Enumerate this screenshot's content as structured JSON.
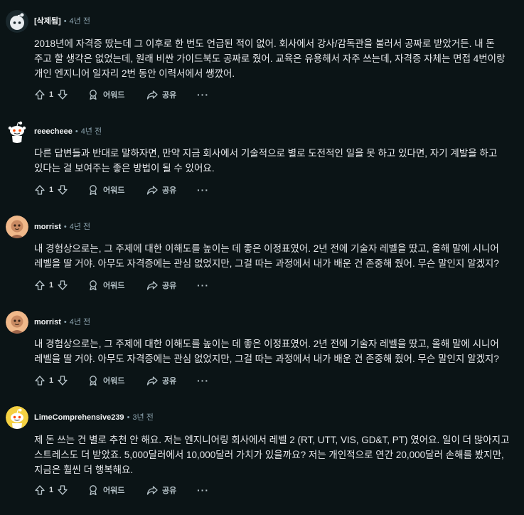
{
  "comments": [
    {
      "author": "[삭제됨]",
      "time": "4년 전",
      "avatar_icon": "default-avatar-icon",
      "lines": [
        "2018년에 자격증 땄는데 그 이후로 한 번도 언급된 적이 없어. 회사에서 강사/감독관을 불러서 공짜로 받았거든. 내 돈",
        "주고 할 생각은 없었는데, 원래 비싼 가이드북도 공짜로 줬어. 교육은 유용해서 자주 쓰는데, 자격증 자체는 면접 4번이랑",
        "개인 엔지니어 일자리 2번 동안 이력서에서 쌩깠어."
      ],
      "votes": "1",
      "award_label": "어워드",
      "share_label": "공유",
      "more_label": "···"
    },
    {
      "author": "reeecheee",
      "time": "4년 전",
      "avatar_icon": "snoo-avatar-icon",
      "lines": [
        "다른 답변들과 반대로 말하자면, 만약 지금 회사에서 기술적으로 별로 도전적인 일을 못 하고 있다면, 자기 계발을 하고",
        "있다는 걸 보여주는 좋은 방법이 될 수 있어요."
      ],
      "votes": "1",
      "award_label": "어워드",
      "share_label": "공유",
      "more_label": "···"
    },
    {
      "author": "morrist",
      "time": "4년 전",
      "avatar_icon": "user-avatar-icon",
      "lines": [
        "내 경험상으로는, 그 주제에 대한 이해도를 높이는 데 좋은 이정표였어. 2년 전에 기술자 레벨을 땄고, 올해 말에 시니어",
        "레벨을 딸 거야. 아무도 자격증에는 관심 없었지만, 그걸 따는 과정에서 내가 배운 건 존중해 줬어. 무슨 말인지 알겠지?"
      ],
      "votes": "1",
      "award_label": "어워드",
      "share_label": "공유",
      "more_label": "···"
    },
    {
      "author": "morrist",
      "time": "4년 전",
      "avatar_icon": "user-avatar-icon",
      "lines": [
        "내 경험상으로는, 그 주제에 대한 이해도를 높이는 데 좋은 이정표였어. 2년 전에 기술자 레벨을 땄고, 올해 말에 시니어",
        "레벨을 딸 거야. 아무도 자격증에는 관심 없었지만, 그걸 따는 과정에서 내가 배운 건 존중해 줬어. 무슨 말인지 알겠지?"
      ],
      "votes": "1",
      "award_label": "어워드",
      "share_label": "공유",
      "more_label": "···"
    },
    {
      "author": "LimeComprehensive239",
      "time": "3년 전",
      "avatar_icon": "snoo-yellow-avatar-icon",
      "lines": [
        "제 돈 쓰는 건 별로 추천 안 해요. 저는 엔지니어링 회사에서 레벨 2 (RT, UTT, VIS, GD&T, PT) 였어요. 일이 더 많아지고",
        "스트레스도 더 받았죠. 5,000달러에서 10,000달러 가치가 있을까요? 저는 개인적으로 연간 20,000달러 손해를 봤지만,",
        "지금은 훨씬 더 행복해요."
      ],
      "votes": "1",
      "award_label": "어워드",
      "share_label": "공유",
      "more_label": "···"
    }
  ],
  "colors": {
    "background": "#0b1416",
    "text": "#e8eaed",
    "meta": "#8ba2ad",
    "action": "#b7c4ca"
  }
}
